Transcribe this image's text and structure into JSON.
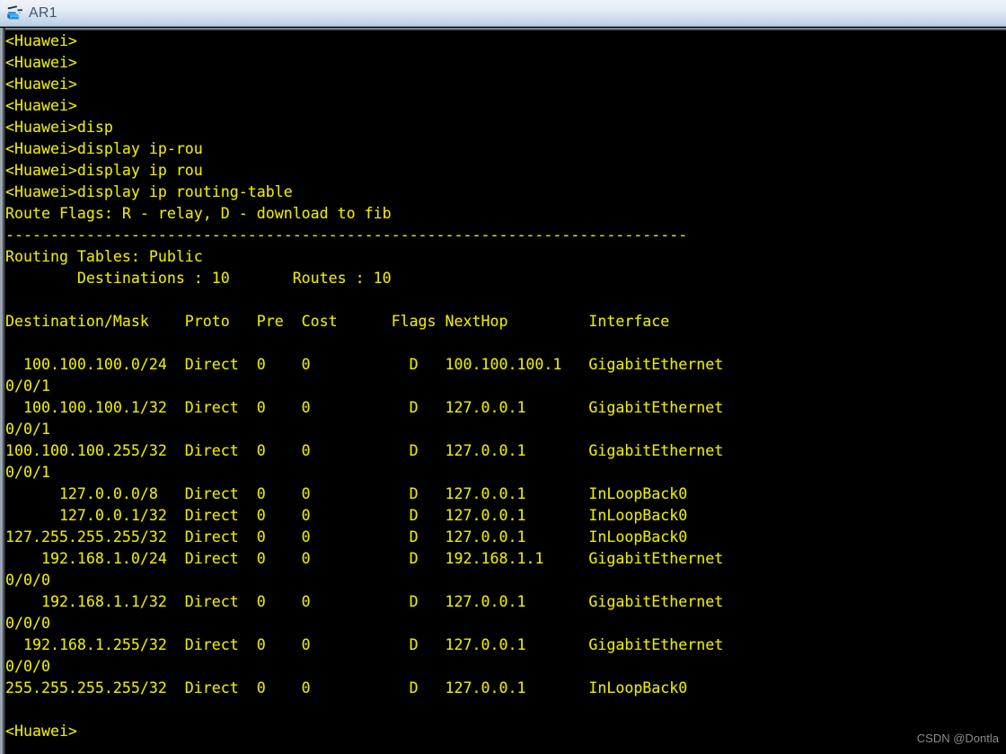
{
  "window": {
    "title": "AR1",
    "icon": "router-device-icon",
    "titlebar_gradient_top": "#eef3fa",
    "titlebar_gradient_bottom": "#b4cbe3",
    "title_color": "#44566b"
  },
  "terminal": {
    "background_color": "#000000",
    "text_color": "#e8e800",
    "prompt": "<Huawei>",
    "lines": [
      "<Huawei>",
      "<Huawei>",
      "<Huawei>",
      "<Huawei>",
      "<Huawei>disp",
      "<Huawei>display ip-rou",
      "<Huawei>display ip rou",
      "<Huawei>display ip routing-table",
      "Route Flags: R - relay, D - download to fib",
      "----------------------------------------------------------------------------",
      "Routing Tables: Public",
      "        Destinations : 10       Routes : 10",
      "",
      "Destination/Mask    Proto   Pre  Cost      Flags NextHop         Interface",
      "",
      "  100.100.100.0/24  Direct  0    0           D   100.100.100.1   GigabitEthernet",
      "0/0/1",
      "  100.100.100.1/32  Direct  0    0           D   127.0.0.1       GigabitEthernet",
      "0/0/1",
      "100.100.100.255/32  Direct  0    0           D   127.0.0.1       GigabitEthernet",
      "0/0/1",
      "      127.0.0.0/8   Direct  0    0           D   127.0.0.1       InLoopBack0",
      "      127.0.0.1/32  Direct  0    0           D   127.0.0.1       InLoopBack0",
      "127.255.255.255/32  Direct  0    0           D   127.0.0.1       InLoopBack0",
      "    192.168.1.0/24  Direct  0    0           D   192.168.1.1     GigabitEthernet",
      "0/0/0",
      "    192.168.1.1/32  Direct  0    0           D   127.0.0.1       GigabitEthernet",
      "0/0/0",
      "  192.168.1.255/32  Direct  0    0           D   127.0.0.1       GigabitEthernet",
      "0/0/0",
      "255.255.255.255/32  Direct  0    0           D   127.0.0.1       InLoopBack0",
      "",
      "<Huawei>"
    ],
    "command_history": [
      "disp",
      "display ip-rou",
      "display ip rou",
      "display ip routing-table"
    ],
    "route_flags_legend": "Route Flags: R - relay, D - download to fib",
    "routing_table_name": "Routing Tables: Public",
    "destinations_count": "10",
    "routes_count": "10",
    "columns": [
      "Destination/Mask",
      "Proto",
      "Pre",
      "Cost",
      "Flags",
      "NextHop",
      "Interface"
    ],
    "routes": [
      {
        "destination_mask": "100.100.100.0/24",
        "proto": "Direct",
        "pre": "0",
        "cost": "0",
        "flags": "D",
        "nexthop": "100.100.100.1",
        "interface": "GigabitEthernet0/0/1"
      },
      {
        "destination_mask": "100.100.100.1/32",
        "proto": "Direct",
        "pre": "0",
        "cost": "0",
        "flags": "D",
        "nexthop": "127.0.0.1",
        "interface": "GigabitEthernet0/0/1"
      },
      {
        "destination_mask": "100.100.100.255/32",
        "proto": "Direct",
        "pre": "0",
        "cost": "0",
        "flags": "D",
        "nexthop": "127.0.0.1",
        "interface": "GigabitEthernet0/0/1"
      },
      {
        "destination_mask": "127.0.0.0/8",
        "proto": "Direct",
        "pre": "0",
        "cost": "0",
        "flags": "D",
        "nexthop": "127.0.0.1",
        "interface": "InLoopBack0"
      },
      {
        "destination_mask": "127.0.0.1/32",
        "proto": "Direct",
        "pre": "0",
        "cost": "0",
        "flags": "D",
        "nexthop": "127.0.0.1",
        "interface": "InLoopBack0"
      },
      {
        "destination_mask": "127.255.255.255/32",
        "proto": "Direct",
        "pre": "0",
        "cost": "0",
        "flags": "D",
        "nexthop": "127.0.0.1",
        "interface": "InLoopBack0"
      },
      {
        "destination_mask": "192.168.1.0/24",
        "proto": "Direct",
        "pre": "0",
        "cost": "0",
        "flags": "D",
        "nexthop": "192.168.1.1",
        "interface": "GigabitEthernet0/0/0"
      },
      {
        "destination_mask": "192.168.1.1/32",
        "proto": "Direct",
        "pre": "0",
        "cost": "0",
        "flags": "D",
        "nexthop": "127.0.0.1",
        "interface": "GigabitEthernet0/0/0"
      },
      {
        "destination_mask": "192.168.1.255/32",
        "proto": "Direct",
        "pre": "0",
        "cost": "0",
        "flags": "D",
        "nexthop": "127.0.0.1",
        "interface": "GigabitEthernet0/0/0"
      },
      {
        "destination_mask": "255.255.255.255/32",
        "proto": "Direct",
        "pre": "0",
        "cost": "0",
        "flags": "D",
        "nexthop": "127.0.0.1",
        "interface": "InLoopBack0"
      }
    ]
  },
  "watermark": {
    "text": "CSDN @Dontla"
  }
}
